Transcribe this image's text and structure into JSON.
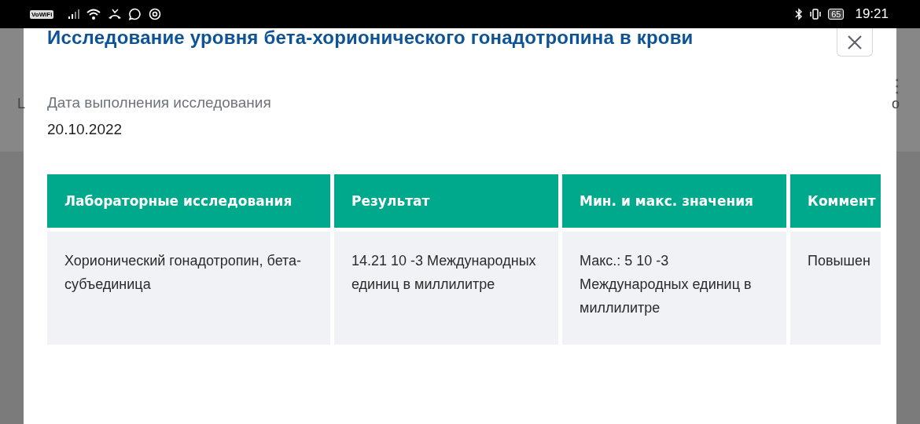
{
  "status_bar": {
    "network_badge": "VoWiFi",
    "battery": "65",
    "time": "19:21"
  },
  "background": {
    "left_fragment": "L",
    "right_fragment": "о"
  },
  "modal": {
    "title": "Исследование уровня бета-хорионического гонадотропина в крови",
    "date_label": "Дата выполнения исследования",
    "date_value": "20.10.2022",
    "table": {
      "columns": [
        "Лабораторные исследования",
        "Результат",
        "Мин. и макс. значения",
        "Коммент"
      ],
      "rows": [
        [
          "Хорионический гонадотропин, бета-субъединица",
          "14.21 10 -3 Международных единиц в миллилитре",
          "Макс.: 5 10 -3 Международных единиц в миллилитре",
          "Повышен"
        ]
      ]
    }
  }
}
